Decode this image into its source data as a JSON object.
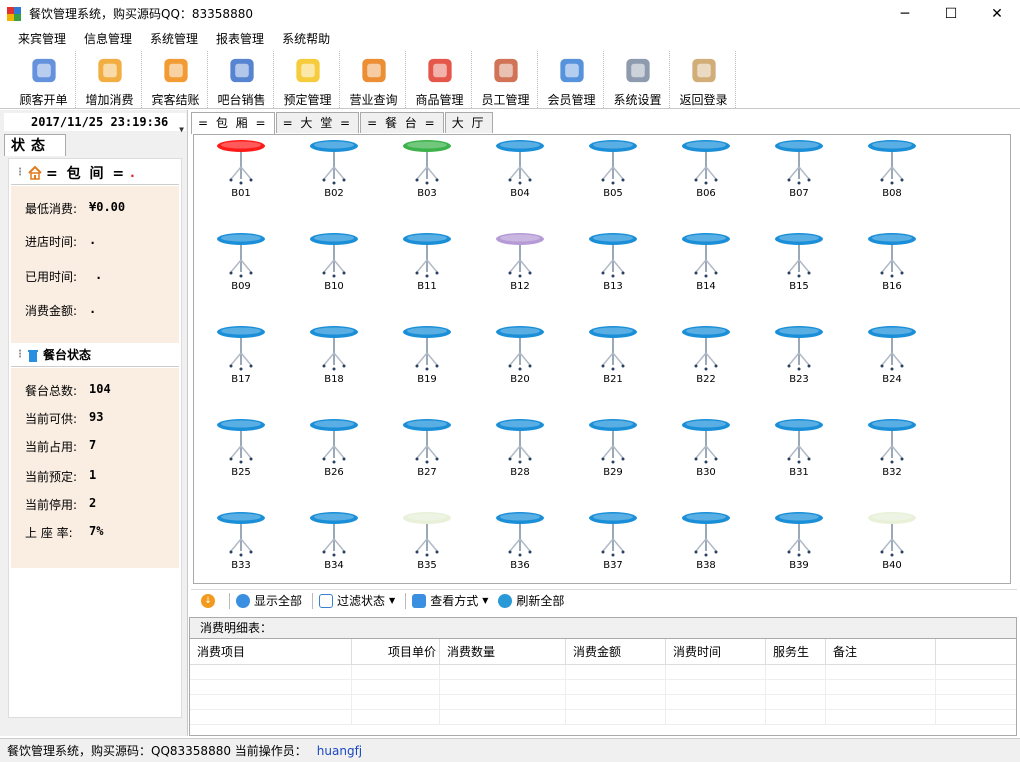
{
  "window": {
    "title": "餐饮管理系统，购买源码QQ：83358880",
    "minimize": "─",
    "maximize": "☐",
    "close": "✕"
  },
  "menu": [
    "来宾管理",
    "信息管理",
    "系统管理",
    "报表管理",
    "系统帮助"
  ],
  "toolbar": [
    {
      "label": "顾客开单",
      "icon": "customer-open-icon"
    },
    {
      "label": "增加消费",
      "icon": "add-consumption-icon"
    },
    {
      "label": "宾客结账",
      "icon": "checkout-icon"
    },
    {
      "label": "吧台销售",
      "icon": "bar-sales-icon"
    },
    {
      "label": "预定管理",
      "icon": "reservation-icon"
    },
    {
      "label": "营业查询",
      "icon": "business-query-icon"
    },
    {
      "label": "商品管理",
      "icon": "product-gear-icon"
    },
    {
      "label": "员工管理",
      "icon": "employee-card-icon"
    },
    {
      "label": "会员管理",
      "icon": "member-card-icon"
    },
    {
      "label": "系统设置",
      "icon": "settings-tools-icon"
    },
    {
      "label": "返回登录",
      "icon": "exit-door-icon"
    }
  ],
  "left_panel": {
    "datetime": "2017/11/25 23:19:36",
    "status_tab": "状态",
    "room_header": "= 包 间 =",
    "room_marker": ".",
    "room_info": [
      {
        "label": "最低消费:",
        "value": "¥0.00"
      },
      {
        "label": "进店时间:",
        "value": "."
      },
      {
        "label": "已用时间:",
        "value": "."
      },
      {
        "label": "消费金额:",
        "value": "."
      }
    ],
    "table_status_header": "餐台状态",
    "table_status": [
      {
        "label": "餐台总数:",
        "value": "104"
      },
      {
        "label": "当前可供:",
        "value": "93"
      },
      {
        "label": "当前占用:",
        "value": "7"
      },
      {
        "label": "当前预定:",
        "value": "1"
      },
      {
        "label": "当前停用:",
        "value": "2"
      },
      {
        "label": "上 座 率:",
        "value": "7%"
      }
    ]
  },
  "tabs": [
    "= 包 厢 =",
    "= 大 堂 =",
    "= 餐 台 =",
    "大 厅"
  ],
  "tables": [
    {
      "id": "B01",
      "state": "occupied"
    },
    {
      "id": "B02",
      "state": "free"
    },
    {
      "id": "B03",
      "state": "reserved"
    },
    {
      "id": "B04",
      "state": "free"
    },
    {
      "id": "B05",
      "state": "free"
    },
    {
      "id": "B06",
      "state": "free"
    },
    {
      "id": "B07",
      "state": "free"
    },
    {
      "id": "B08",
      "state": "free"
    },
    {
      "id": "B09",
      "state": "free"
    },
    {
      "id": "B10",
      "state": "free"
    },
    {
      "id": "B11",
      "state": "free"
    },
    {
      "id": "B12",
      "state": "dining"
    },
    {
      "id": "B13",
      "state": "free"
    },
    {
      "id": "B14",
      "state": "free"
    },
    {
      "id": "B15",
      "state": "free"
    },
    {
      "id": "B16",
      "state": "free"
    },
    {
      "id": "B17",
      "state": "free"
    },
    {
      "id": "B18",
      "state": "free"
    },
    {
      "id": "B19",
      "state": "free"
    },
    {
      "id": "B20",
      "state": "free"
    },
    {
      "id": "B21",
      "state": "free"
    },
    {
      "id": "B22",
      "state": "free"
    },
    {
      "id": "B23",
      "state": "free"
    },
    {
      "id": "B24",
      "state": "free"
    },
    {
      "id": "B25",
      "state": "free"
    },
    {
      "id": "B26",
      "state": "free"
    },
    {
      "id": "B27",
      "state": "free"
    },
    {
      "id": "B28",
      "state": "free"
    },
    {
      "id": "B29",
      "state": "free"
    },
    {
      "id": "B30",
      "state": "free"
    },
    {
      "id": "B31",
      "state": "free"
    },
    {
      "id": "B32",
      "state": "free"
    },
    {
      "id": "B33",
      "state": "free"
    },
    {
      "id": "B34",
      "state": "free"
    },
    {
      "id": "B35",
      "state": "disabled"
    },
    {
      "id": "B36",
      "state": "free"
    },
    {
      "id": "B37",
      "state": "free"
    },
    {
      "id": "B38",
      "state": "free"
    },
    {
      "id": "B39",
      "state": "free"
    },
    {
      "id": "B40",
      "state": "disabled"
    }
  ],
  "state_colors": {
    "free": "#1a8fd8",
    "occupied": "#ff1a1a",
    "reserved": "#3bb24a",
    "dining": "#b59ad6",
    "disabled": "#e8f0d8"
  },
  "filterbar": {
    "show_all": "显示全部",
    "filter_status": "过滤状态",
    "view_mode": "查看方式",
    "refresh_all": "刷新全部"
  },
  "detail": {
    "title": "消费明细表：",
    "columns": [
      "消费项目",
      "项目单价",
      "消费数量",
      "消费金额",
      "消费时间",
      "服务生",
      "备注"
    ]
  },
  "statusbar": {
    "text": "餐饮管理系统，购买源码：QQ83358880   当前操作员：",
    "operator": "huangfj"
  }
}
